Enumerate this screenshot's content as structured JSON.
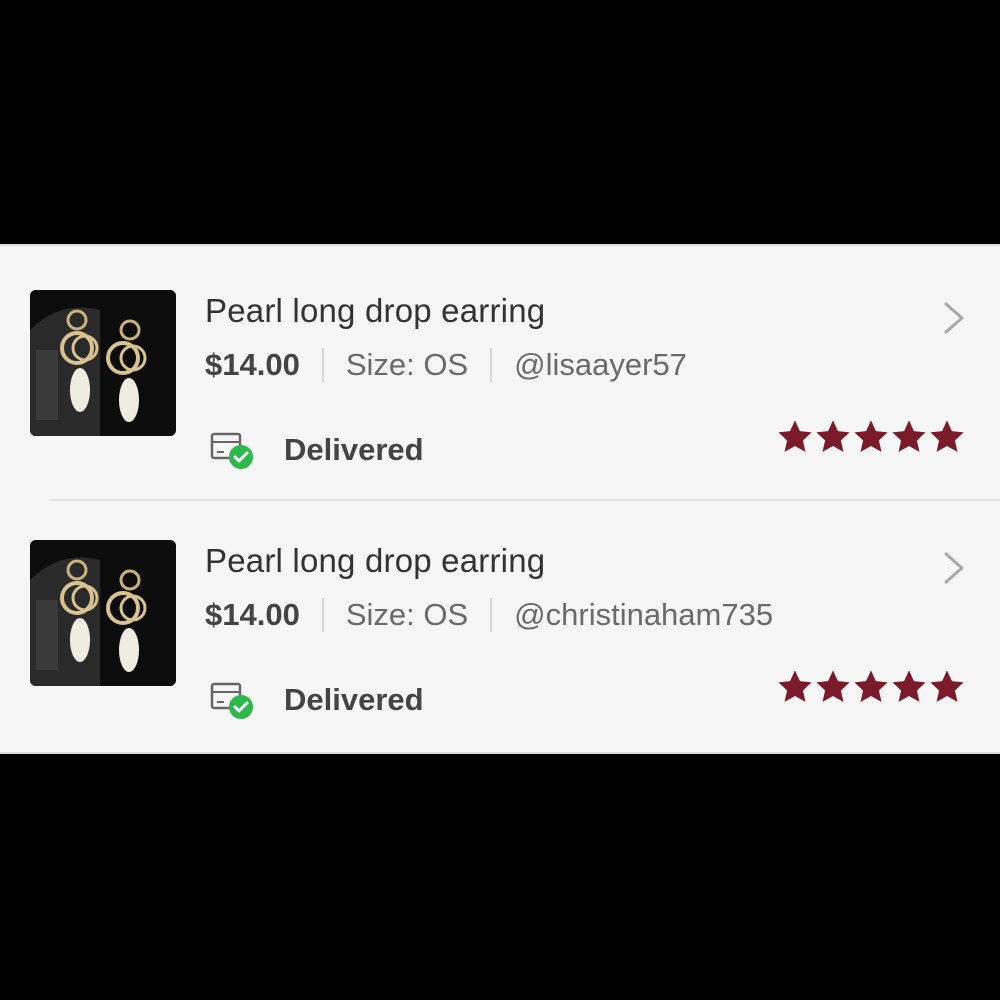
{
  "colors": {
    "star": "#7a1a2a",
    "check": "#2db84b",
    "text": "#333333"
  },
  "orders": [
    {
      "title": "Pearl long drop earring",
      "price": "$14.00",
      "size": "Size: OS",
      "buyer": "@lisaayer57",
      "status": "Delivered",
      "rating": 5
    },
    {
      "title": "Pearl long drop earring",
      "price": "$14.00",
      "size": "Size: OS",
      "buyer": "@christinaham735",
      "status": "Delivered",
      "rating": 5
    }
  ]
}
